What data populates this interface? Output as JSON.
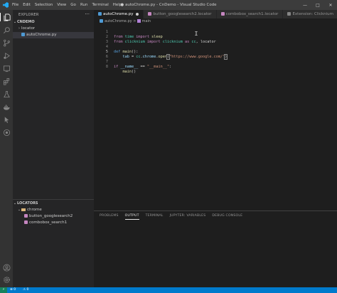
{
  "window": {
    "title": "● autoChrome.py - CnDemo - Visual Studio Code",
    "menu": [
      "File",
      "Edit",
      "Selection",
      "View",
      "Go",
      "Run",
      "Terminal",
      "Help"
    ],
    "controls": [
      "—",
      "□",
      "✕"
    ]
  },
  "activity_bar": {
    "icons": [
      "files-icon",
      "search-icon",
      "source-control-icon",
      "run-debug-icon",
      "remote-explorer-icon",
      "extensions-icon",
      "testing-icon",
      "docker-icon",
      "clicknium-icon",
      "python-icon"
    ],
    "bottom_icons": [
      "account-icon",
      "settings-gear-icon"
    ]
  },
  "sidebar": {
    "title": "EXPLORER",
    "more": "···",
    "workspace": "CNDEMO",
    "items": [
      {
        "label": "locator",
        "type": "folder"
      },
      {
        "label": "autoChrome.py",
        "type": "file"
      }
    ],
    "locators": {
      "title": "LOCATORS",
      "root": "chrome",
      "children": [
        "button_googlesearch2",
        "combobox_search1"
      ]
    }
  },
  "tabs": [
    {
      "label": "autoChrome.py",
      "active": true,
      "dirty": true
    },
    {
      "label": "button_googlesearch2.locator",
      "active": false
    },
    {
      "label": "combobox_search1.locator",
      "active": false
    },
    {
      "label": "Extension: Clicknium",
      "active": false
    }
  ],
  "breadcrumb": {
    "file": "autoChrome.py",
    "sep": ">",
    "symbol": "main"
  },
  "code": {
    "line_numbers": [
      "1",
      "2",
      "3",
      "4",
      "5",
      "6",
      "7",
      "8"
    ],
    "current_line": "5",
    "l1": {
      "k1": "from",
      "mod": "time",
      "k2": "import",
      "name": "sleep"
    },
    "l2": {
      "k1": "from",
      "mod": "clicknium",
      "k2": "import",
      "name": "clicknium",
      "k3": "as",
      "alias": "cc",
      "rest": ", locator"
    },
    "l4": {
      "k": "def",
      "fn": "main",
      "rest": "():"
    },
    "l5": {
      "var": "tab",
      "eq": " = ",
      "obj": "cc",
      "dot1": ".",
      "attr": "chrome",
      "dot2": ".",
      "fn": "open",
      "open": "(",
      "str": "\"https://www.google.com/\"",
      "close": ")"
    },
    "l7": {
      "k": "if",
      "var": "__name__",
      "eq": " == ",
      "str": "\"__main__\"",
      "colon": ":"
    },
    "l8": {
      "fn": "main",
      "rest": "()"
    }
  },
  "panel": {
    "tabs": [
      "PROBLEMS",
      "OUTPUT",
      "TERMINAL",
      "JUPYTER: VARIABLES",
      "DEBUG CONSOLE"
    ],
    "active": "OUTPUT"
  },
  "statusbar": {
    "remote": "⚡",
    "errors": "⊗ 0",
    "warnings": "⚠ 0"
  }
}
